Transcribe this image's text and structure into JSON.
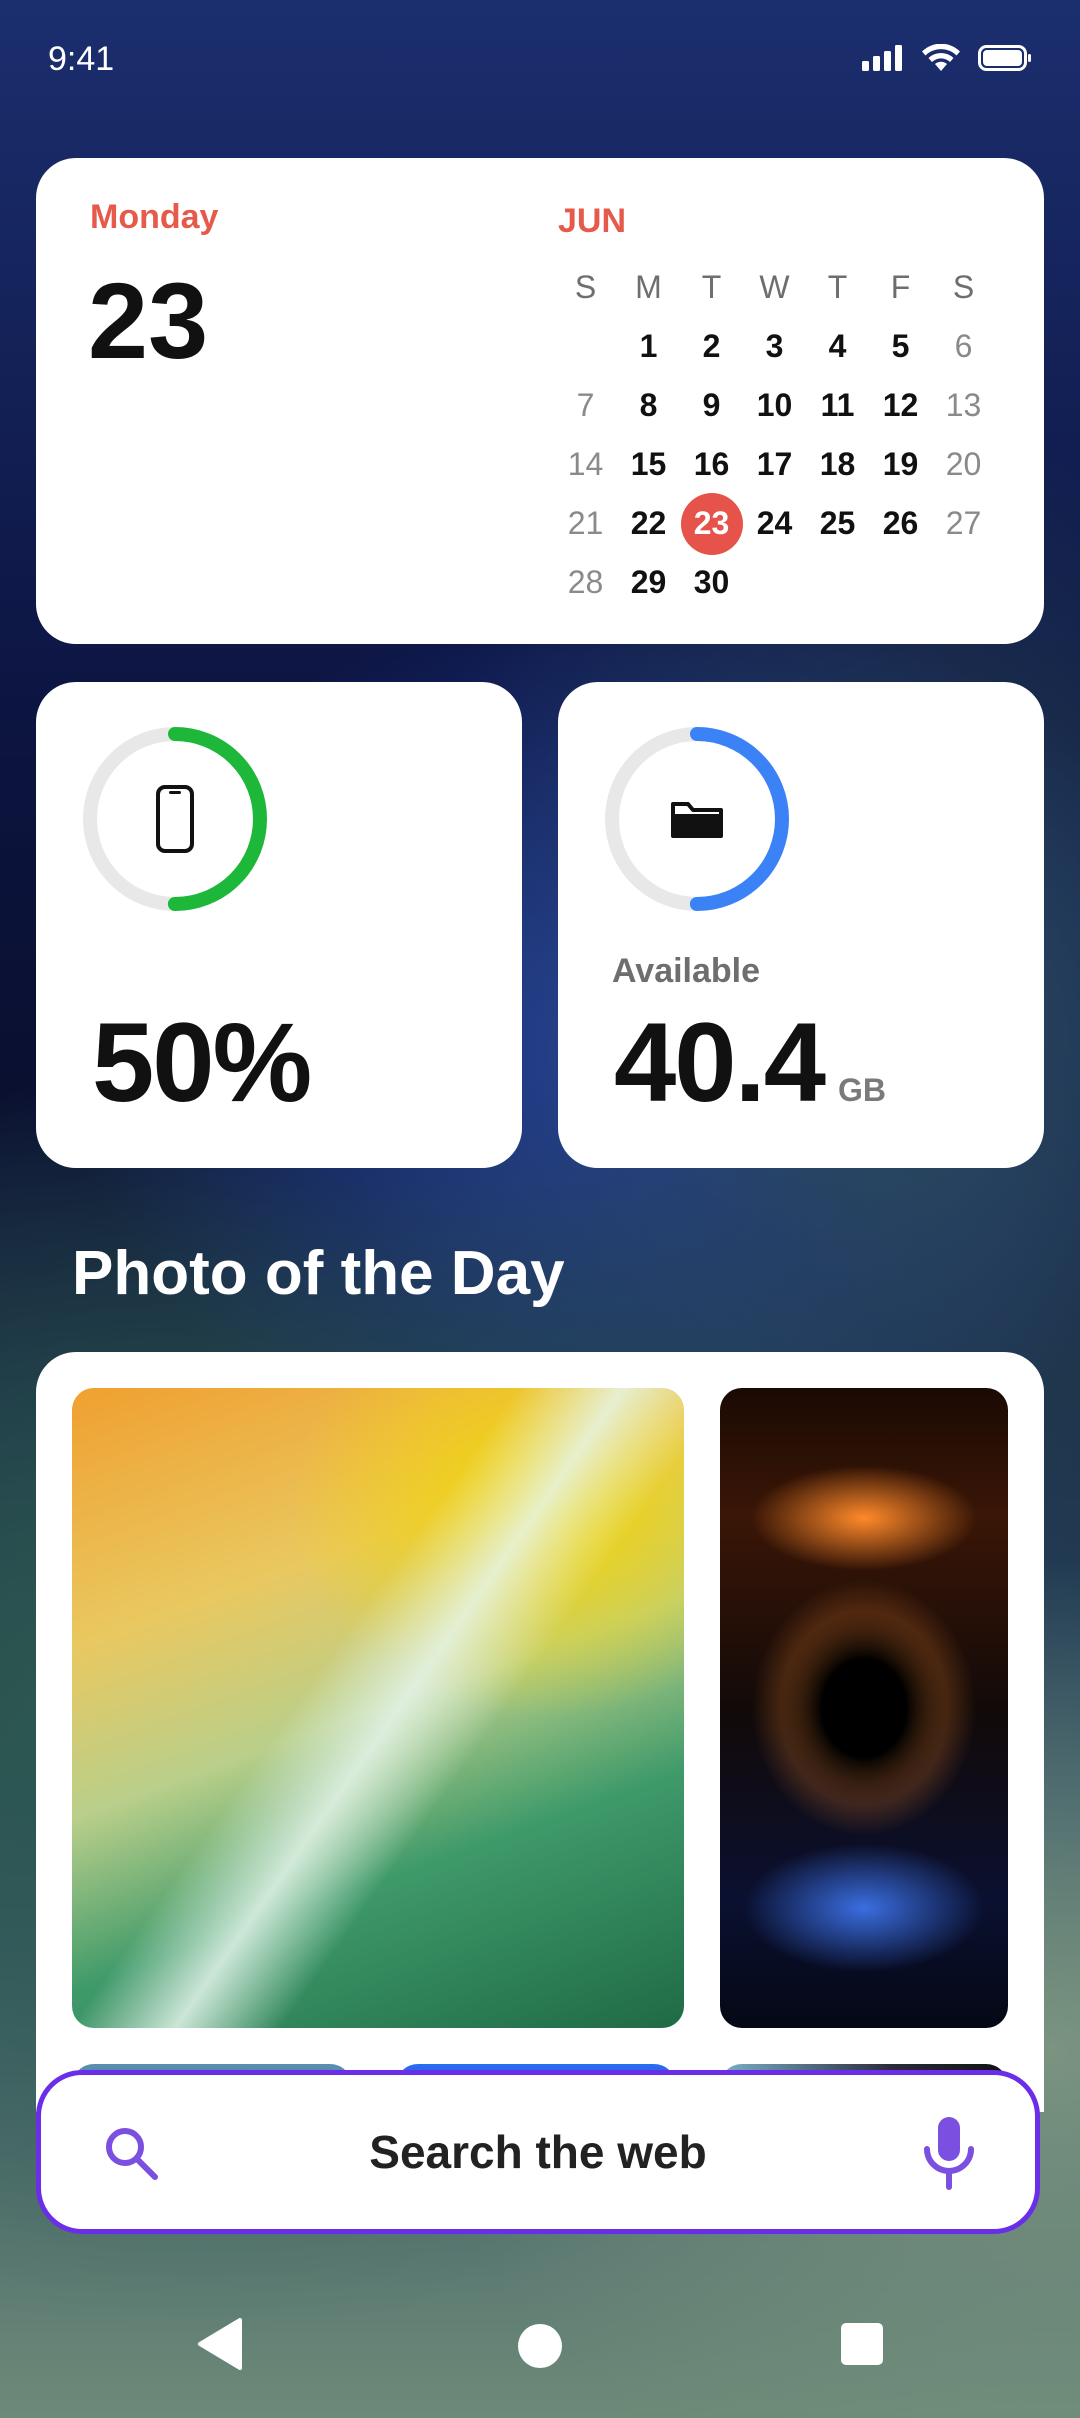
{
  "status_bar": {
    "time": "9:41"
  },
  "calendar": {
    "weekday": "Monday",
    "date": "23",
    "month": "JUN",
    "weekday_headers": [
      "S",
      "M",
      "T",
      "W",
      "T",
      "F",
      "S"
    ],
    "weeks": [
      [
        "",
        "1",
        "2",
        "3",
        "4",
        "5",
        "6"
      ],
      [
        "7",
        "8",
        "9",
        "10",
        "11",
        "12",
        "13"
      ],
      [
        "14",
        "15",
        "16",
        "17",
        "18",
        "19",
        "20"
      ],
      [
        "21",
        "22",
        "23",
        "24",
        "25",
        "26",
        "27"
      ],
      [
        "28",
        "29",
        "30",
        "",
        "",
        "",
        ""
      ]
    ],
    "today": "23",
    "accent_color": "#e5534b"
  },
  "battery_widget": {
    "value": "50%",
    "level_fraction": 0.5,
    "ring_color": "#1db83a",
    "icon": "phone-icon"
  },
  "storage_widget": {
    "label": "Available",
    "value": "40.4",
    "unit": "GB",
    "used_fraction": 0.5,
    "ring_color": "#3b82f6",
    "icon": "folder-icon"
  },
  "photo_section": {
    "title": "Photo of the Day"
  },
  "search": {
    "label": "Search the web",
    "border_color": "#6a2ee8",
    "icon_color": "#7b4fe0"
  },
  "nav_bar": {
    "buttons": [
      "back-icon",
      "home-icon",
      "recents-icon"
    ]
  }
}
